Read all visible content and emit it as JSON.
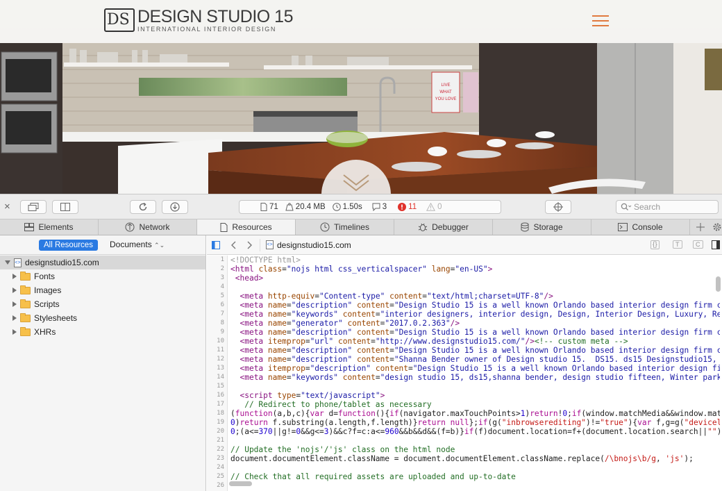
{
  "site": {
    "logo_mark": "DS",
    "logo_title": "DESIGN STUDIO 15",
    "logo_subtitle": "INTERNATIONAL INTERIOR DESIGN",
    "art_text": "LIVE WHAT YOU LOVE"
  },
  "toolbar": {
    "close_glyph": "×",
    "resource_count": "71",
    "size": "20.4 MB",
    "load_time": "1.50s",
    "logs": "3",
    "errors": "11",
    "warnings": "0",
    "search_placeholder": "Search"
  },
  "tabs": [
    {
      "label": "Elements"
    },
    {
      "label": "Network"
    },
    {
      "label": "Resources"
    },
    {
      "label": "Timelines"
    },
    {
      "label": "Debugger"
    },
    {
      "label": "Storage"
    },
    {
      "label": "Console"
    }
  ],
  "sidebar": {
    "filter_all": "All Resources",
    "filter_docs": "Documents",
    "root": "designstudio15.com",
    "folders": [
      "Fonts",
      "Images",
      "Scripts",
      "Stylesheets",
      "XHRs"
    ]
  },
  "content": {
    "file_name": "designstudio15.com",
    "line_numbers": [
      "1",
      "2",
      "3",
      "4",
      "5",
      "6",
      "7",
      "8",
      "9",
      "10",
      "11",
      "12",
      "13",
      "14",
      "15",
      "16",
      "17",
      "18",
      "19",
      "20",
      "21",
      "22",
      "23",
      "24",
      "25",
      "26"
    ]
  },
  "colors": {
    "accent_blue": "#2a7ae2",
    "error_red": "#e0322b",
    "hamburger_orange": "#e07a3f"
  }
}
